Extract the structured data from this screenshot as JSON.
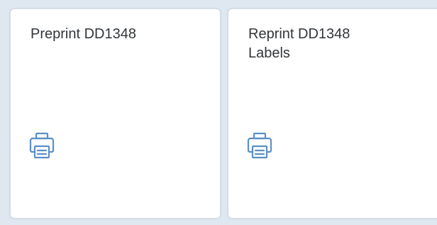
{
  "tiles": [
    {
      "title": "Preprint DD1348",
      "icon": "printer-icon"
    },
    {
      "title": "Reprint DD1348\nLabels",
      "icon": "printer-icon"
    }
  ],
  "colors": {
    "background": "#dfe8f1",
    "tile_background": "#ffffff",
    "title_text": "#32363a",
    "icon": "#5b8fc7"
  }
}
